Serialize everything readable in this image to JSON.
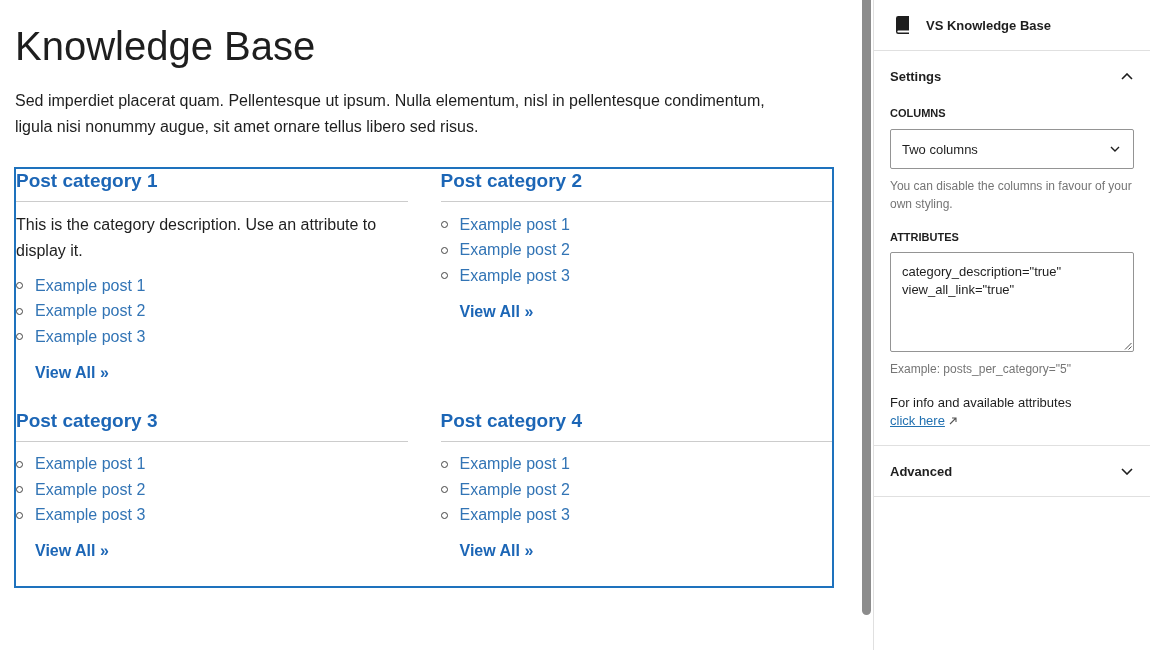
{
  "page": {
    "title": "Knowledge Base",
    "intro": "Sed imperdiet placerat quam. Pellentesque ut ipsum. Nulla elementum, nisl in pellentesque condimentum, ligula nisi nonummy augue, sit amet ornare tellus libero sed risus."
  },
  "knowledge_base": {
    "categories": [
      {
        "title": "Post category 1",
        "description": "This is the category description. Use an attribute to display it.",
        "posts": [
          "Example post 1",
          "Example post 2",
          "Example post 3"
        ],
        "view_all": "View All »"
      },
      {
        "title": "Post category 2",
        "posts": [
          "Example post 1",
          "Example post 2",
          "Example post 3"
        ],
        "view_all": "View All »"
      },
      {
        "title": "Post category 3",
        "posts": [
          "Example post 1",
          "Example post 2",
          "Example post 3"
        ],
        "view_all": "View All »"
      },
      {
        "title": "Post category 4",
        "posts": [
          "Example post 1",
          "Example post 2",
          "Example post 3"
        ],
        "view_all": "View All »"
      }
    ]
  },
  "sidebar": {
    "block": {
      "title": "VS Knowledge Base"
    },
    "panels": [
      {
        "title": "Settings",
        "expanded": true,
        "fields": [
          {
            "kind": "select",
            "label": "COLUMNS",
            "value": "Two columns",
            "help": "You can disable the columns in favour of your own styling."
          },
          {
            "kind": "textarea",
            "label": "ATTRIBUTES",
            "value": "category_description=\"true\"\nview_all_link=\"true\"",
            "help": "Example: posts_per_category=\"5\""
          }
        ],
        "note": {
          "text": "For info and available attributes",
          "link": "click here"
        }
      },
      {
        "title": "Advanced",
        "expanded": false
      }
    ]
  }
}
